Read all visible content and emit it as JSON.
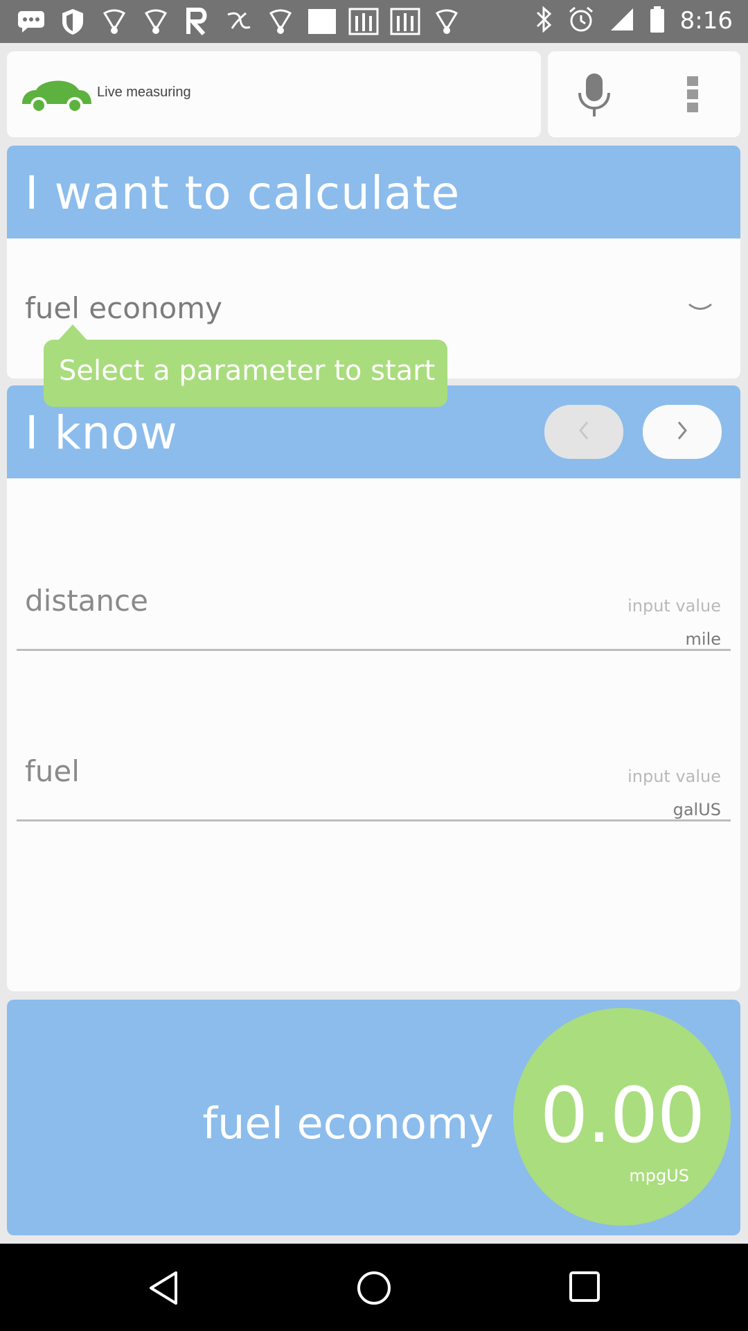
{
  "status_bar": {
    "time": "8:16",
    "icons": [
      "chat-bubble-icon",
      "shield-icon",
      "lightbulb-icon",
      "lightbulb-icon",
      "r-logo-icon",
      "swirl-icon",
      "lightbulb-icon",
      "blank-square-icon",
      "rfi-logo-icon",
      "rfi-logo-icon",
      "lightbulb-icon",
      "bluetooth-icon",
      "alarm-icon",
      "signal-icon",
      "battery-icon"
    ]
  },
  "toolbar": {
    "title": "Live measuring",
    "icons": {
      "logo": "car-icon",
      "voice": "mic-icon",
      "menu": "overflow-menu-icon"
    }
  },
  "calculate_section": {
    "heading": "I want to calculate",
    "selected_parameter": "fuel economy",
    "tooltip": "Select a parameter to start"
  },
  "know_section": {
    "heading": "I know",
    "fields": [
      {
        "label": "distance",
        "placeholder": "input value",
        "unit": "mile"
      },
      {
        "label": "fuel",
        "placeholder": "input value",
        "unit": "galUS"
      }
    ]
  },
  "result": {
    "label": "fuel economy",
    "value": "0.00",
    "unit": "mpgUS"
  },
  "colors": {
    "header_blue": "#8bbcec",
    "accent_green": "#aadd7e",
    "status_bar": "#737373"
  }
}
